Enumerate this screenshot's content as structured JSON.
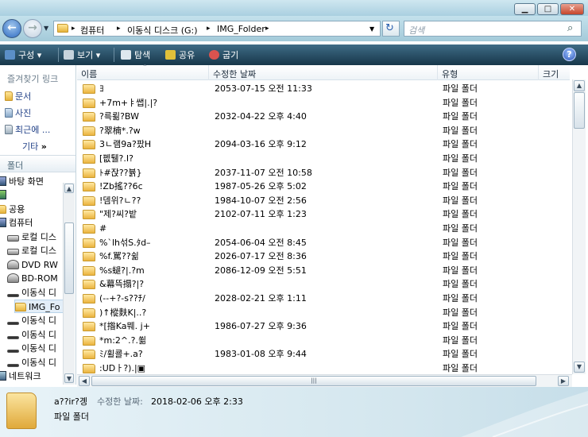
{
  "window": {
    "minimize": "▁",
    "maximize": "□",
    "close": "✕"
  },
  "address": {
    "crumbs": [
      "컴퓨터",
      "이동식 디스크 (G:)",
      "IMG_Folder"
    ],
    "separator": "▸",
    "search_placeholder": "검색"
  },
  "toolbar": {
    "items": [
      {
        "label": "구성",
        "icon": "organize-icon",
        "color": "#5b8fc7"
      },
      {
        "label": "보기",
        "icon": "views-icon",
        "color": "#c7d3dc"
      },
      {
        "label": "탐색",
        "icon": "explore-icon",
        "color": "#dfe8ee"
      },
      {
        "label": "공유",
        "icon": "share-icon",
        "color": "#e0c03a"
      },
      {
        "label": "굽기",
        "icon": "burn-icon",
        "color": "#d9534f"
      }
    ],
    "dropdown_glyph": "▾",
    "help": "?"
  },
  "nav": {
    "favorites_title": "즐겨찾기 링크",
    "links": [
      "문서",
      "사진",
      "최근에 ...",
      "기타"
    ],
    "more": "»",
    "folders_title": "폴더",
    "tree": [
      {
        "label": "바탕 화면",
        "icon": "desktop-icon",
        "indent": 0
      },
      {
        "label": "",
        "icon": "user-icon",
        "indent": 0
      },
      {
        "label": "공용",
        "icon": "folder-icon",
        "indent": 0
      },
      {
        "label": "컴퓨터",
        "icon": "computer-icon",
        "indent": 0
      },
      {
        "label": "로컬 디스",
        "icon": "drive-icon",
        "indent": 1
      },
      {
        "label": "로컬 디스",
        "icon": "drive-icon",
        "indent": 1
      },
      {
        "label": "DVD RW",
        "icon": "dvd-icon",
        "indent": 1
      },
      {
        "label": "BD-ROM",
        "icon": "dvd-icon",
        "indent": 1
      },
      {
        "label": "이동식 디",
        "icon": "drive-icon",
        "indent": 1
      },
      {
        "label": "IMG_Fo",
        "icon": "folder-icon",
        "indent": 2,
        "selected": true
      },
      {
        "label": "이동식 디",
        "icon": "drive-icon",
        "indent": 1
      },
      {
        "label": "이동식 디",
        "icon": "drive-icon",
        "indent": 1
      },
      {
        "label": "이동식 디",
        "icon": "drive-icon",
        "indent": 1
      },
      {
        "label": "이동식 디",
        "icon": "drive-icon",
        "indent": 1
      },
      {
        "label": "네트워크",
        "icon": "network-icon",
        "indent": 0
      }
    ]
  },
  "columns": {
    "name": "이름",
    "date": "수정한 날짜",
    "type": "유형",
    "size": "크기"
  },
  "files": [
    {
      "name": "ﾖ",
      "date": "2053-07-15 오전 11:33",
      "type": "파일 폴더"
    },
    {
      "name": "+7m+ㅑ쌥|.|?",
      "date": "",
      "type": "파일 폴더"
    },
    {
      "name": "?륵뢺?BW",
      "date": "2032-04-22 오후 4:40",
      "type": "파일 폴더"
    },
    {
      "name": "?翠楠*.?w",
      "date": "",
      "type": "파일 폴더"
    },
    {
      "name": "3ㄴ램9a?팠H",
      "date": "2094-03-16 오후 9:12",
      "type": "파일 폴더"
    },
    {
      "name": "[펪퉬?.I?",
      "date": "",
      "type": "파일 폴더"
    },
    {
      "name": "ﾄ#잕??뷹}",
      "date": "2037-11-07 오전 10:58",
      "type": "파일 폴더"
    },
    {
      "name": "!Zb搖??6c",
      "date": "1987-05-26 오후 5:02",
      "type": "파일 폴더"
    },
    {
      "name": "!뎀위?ㄴ??",
      "date": "1984-10-07 오전 2:56",
      "type": "파일 폴더"
    },
    {
      "name": "\"제?씨?밭",
      "date": "2102-07-11 오후 1:23",
      "type": "파일 폴더"
    },
    {
      "name": "#",
      "date": "",
      "type": "파일 폴더"
    },
    {
      "name": "%`lh섞S.ﾀd–",
      "date": "2054-06-04 오전 8:45",
      "type": "파일 폴더"
    },
    {
      "name": "%f.駡??쉶",
      "date": "2026-07-17 오전 8:36",
      "type": "파일 폴더"
    },
    {
      "name": "%s螁?|.?m",
      "date": "2086-12-09 오전 5:51",
      "type": "파일 폴더"
    },
    {
      "name": "&幕뜩搨?|?",
      "date": "",
      "type": "파일 폴더"
    },
    {
      "name": "(--+?-s??ﾁ/",
      "date": "2028-02-21 오후 1:11",
      "type": "파일 폴더"
    },
    {
      "name": ")↑樅麩K|..?",
      "date": "",
      "type": "파일 폴더"
    },
    {
      "name": "*[揝Ka뭬. j+",
      "date": "1986-07-27 오후 9:36",
      "type": "파일 폴더"
    },
    {
      "name": "*m:2^.?.쐶",
      "date": "",
      "type": "파일 폴더"
    },
    {
      "name": "ﾐ/휠쿌+.a?",
      "date": "1983-01-08 오후 9:44",
      "type": "파일 폴더"
    },
    {
      "name": ":UDㅏ?).|▣",
      "date": "",
      "type": "파일 폴더"
    }
  ],
  "details": {
    "name": "a??ir?곙",
    "date_label": "수정한 날짜:",
    "date_value": "2018-02-06 오후 2:33",
    "type": "파일 폴더"
  }
}
